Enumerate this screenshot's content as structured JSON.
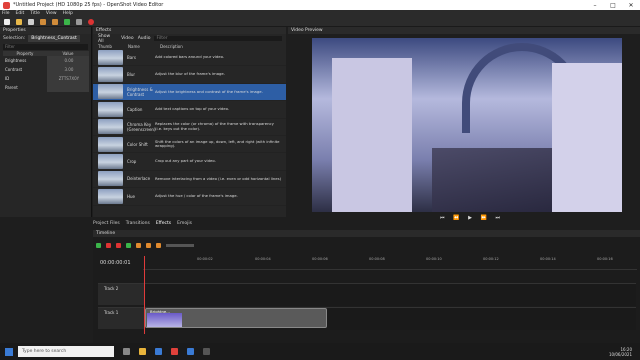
{
  "window": {
    "title": "*Untitled Project (HD 1080p 25 fps) - OpenShot Video Editor"
  },
  "menu": [
    "File",
    "Edit",
    "Title",
    "View",
    "Help"
  ],
  "properties": {
    "panel_title": "Properties",
    "selection_label": "Selection:",
    "selection_value": "Brightness_Contrast",
    "filter_placeholder": "Filter",
    "columns": [
      "Property",
      "Value"
    ],
    "rows": [
      {
        "name": "Brightness",
        "value": "0.00"
      },
      {
        "name": "Contrast",
        "value": "3.00"
      },
      {
        "name": "ID",
        "value": "ZTTS7X0Y"
      },
      {
        "name": "Parent",
        "value": ""
      }
    ]
  },
  "effects": {
    "panel_title": "Effects",
    "tabs": [
      "Show All",
      "Video",
      "Audio"
    ],
    "filter_placeholder": "Filter",
    "columns": [
      "Thumb",
      "Name",
      "Description"
    ],
    "items": [
      {
        "name": "Bars",
        "desc": "Add colored bars around your video."
      },
      {
        "name": "Blur",
        "desc": "Adjust the blur of the frame's image."
      },
      {
        "name": "Brightness & Contrast",
        "desc": "Adjust the brightness and contrast of the frame's image."
      },
      {
        "name": "Caption",
        "desc": "Add text captions on top of your video."
      },
      {
        "name": "Chroma Key (Greenscreen)",
        "desc": "Replaces the color (or chroma) of the frame with transparency (i.e. keys out the color)."
      },
      {
        "name": "Color Shift",
        "desc": "Shift the colors of an image up, down, left, and right (with infinite wrapping)."
      },
      {
        "name": "Crop",
        "desc": "Crop out any part of your video."
      },
      {
        "name": "Deinterlace",
        "desc": "Remove interlacing from a video (i.e. even or odd horizontal lines)"
      },
      {
        "name": "Hue",
        "desc": "Adjust the hue / color of the frame's image."
      }
    ]
  },
  "video_preview": {
    "panel_title": "Video Preview"
  },
  "bottom_tabs": [
    "Project Files",
    "Transitions",
    "Effects",
    "Emojis"
  ],
  "timeline": {
    "panel_title": "Timeline",
    "timecode": "00:00:00:01",
    "ruler": [
      "00:00:02",
      "00:00:04",
      "00:00:06",
      "00:00:08",
      "00:00:10",
      "00:00:12",
      "00:00:14",
      "00:00:16"
    ],
    "tracks": [
      "Track 2",
      "Track 1"
    ],
    "clip_label": "Brightne..."
  },
  "taskbar": {
    "search_placeholder": "Type here to search",
    "time": "16:20",
    "date": "10/06/2021"
  }
}
